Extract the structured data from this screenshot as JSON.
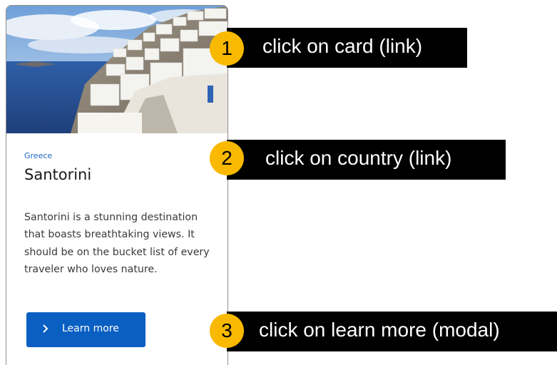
{
  "card": {
    "country": "Greece",
    "title": "Santorini",
    "description": "Santorini is a stunning destination that boasts breathtaking views. It should be on the bucket list of every traveler who loves nature.",
    "button_label": "Learn more",
    "button_icon": "chevron-right-icon",
    "accent_color": "#0a5fc2"
  },
  "annotations": [
    {
      "number": "1",
      "label": "click on card (link)"
    },
    {
      "number": "2",
      "label": "click on country (link)"
    },
    {
      "number": "3",
      "label": "click on learn more (modal)"
    }
  ],
  "badge_color": "#f9b900"
}
